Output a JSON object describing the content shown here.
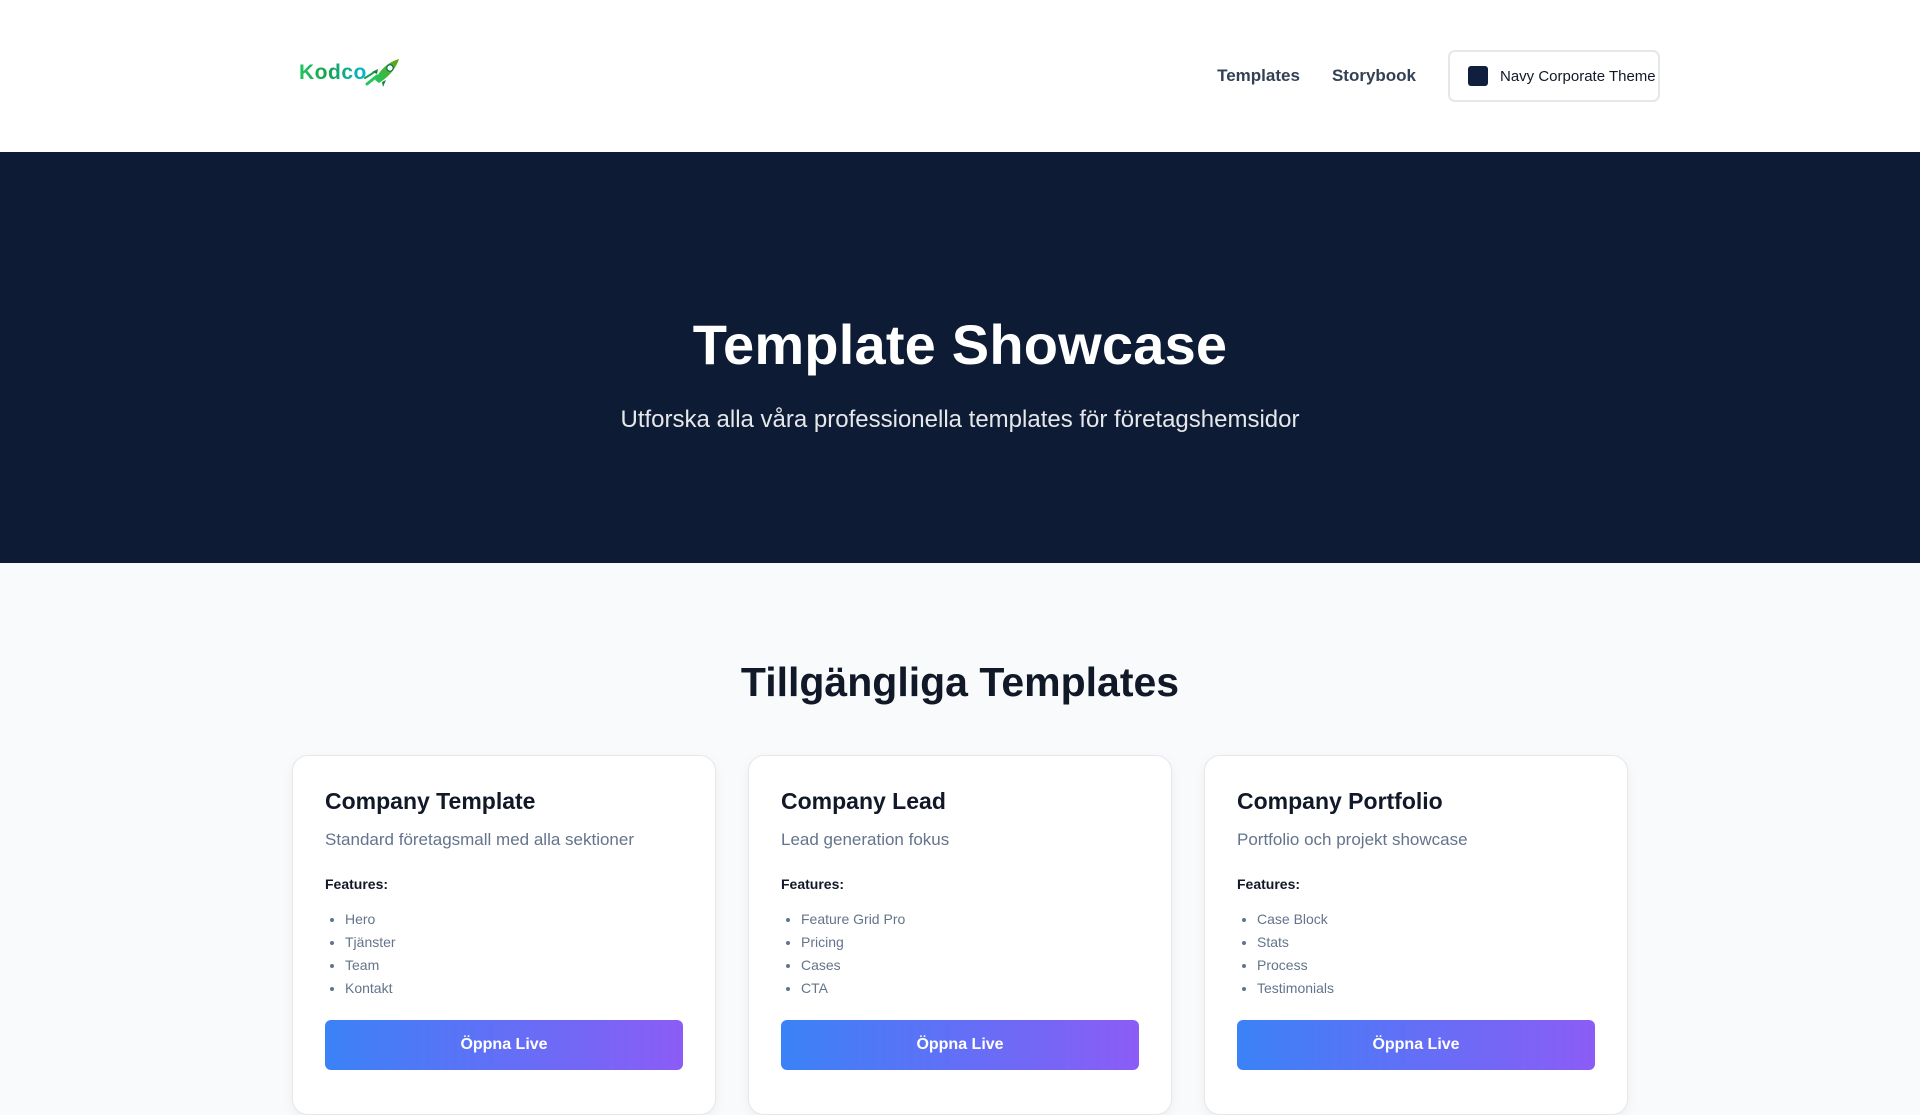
{
  "header": {
    "logo_text": "Kodco",
    "nav": [
      {
        "label": "Templates"
      },
      {
        "label": "Storybook"
      }
    ],
    "theme_button": {
      "label": "Navy Corporate Theme",
      "swatch_color": "#0f1f3d"
    }
  },
  "hero": {
    "title": "Template Showcase",
    "subtitle": "Utforska alla våra professionella templates för företagshemsidor",
    "background": "#0d1b34"
  },
  "templates": {
    "title": "Tillgängliga Templates",
    "features_label": "Features:",
    "button_label": "Öppna Live",
    "items": [
      {
        "title": "Company Template",
        "description": "Standard företagsmall med alla sektioner",
        "features": [
          "Hero",
          "Tjänster",
          "Team",
          "Kontakt"
        ]
      },
      {
        "title": "Company Lead",
        "description": "Lead generation fokus",
        "features": [
          "Feature Grid Pro",
          "Pricing",
          "Cases",
          "CTA"
        ]
      },
      {
        "title": "Company Portfolio",
        "description": "Portfolio och projekt showcase",
        "features": [
          "Case Block",
          "Stats",
          "Process",
          "Testimonials"
        ]
      }
    ]
  },
  "colors": {
    "accent_gradient_start": "#3b82f6",
    "accent_gradient_end": "#8b5cf6"
  }
}
